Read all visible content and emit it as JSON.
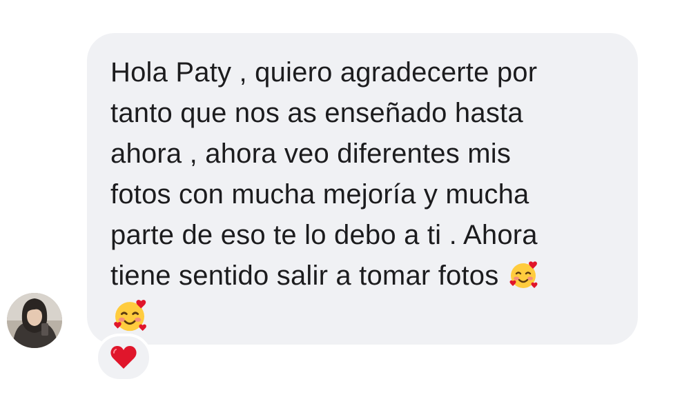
{
  "message": {
    "line_1": "Hola Paty , quiero agradecerte por",
    "line_2": "tanto que nos as enseñado hasta",
    "line_3": "ahora , ahora veo diferentes mis",
    "line_4": "fotos con mucha mejoría y mucha",
    "line_5": "parte de eso te lo debo a ti . Ahora",
    "line_6": "tiene sentido salir a tomar fotos",
    "emoji_icon": "smiling-face-with-hearts-icon"
  },
  "reaction": {
    "icon": "red-heart-icon"
  },
  "sender": {
    "avatar_icon": "profile-photo-avatar"
  },
  "colors": {
    "bubble_bg": "#f0f1f4",
    "text": "#1c1c1e",
    "heart": "#e0162b",
    "emoji_face": "#ffcc3e"
  }
}
